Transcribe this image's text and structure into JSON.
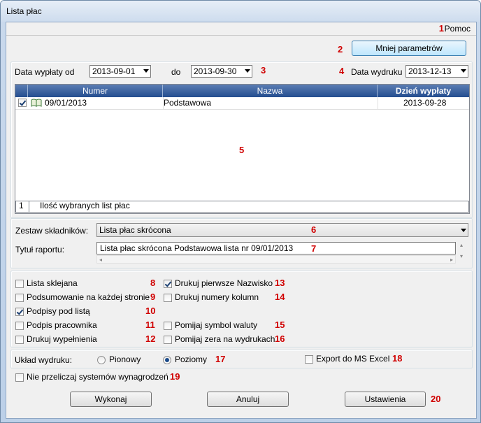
{
  "window": {
    "title": "Lista płac"
  },
  "menu": {
    "help": "Pomoc"
  },
  "markers": [
    "1",
    "2",
    "3",
    "4",
    "5",
    "6",
    "7",
    "8",
    "9",
    "10",
    "11",
    "12",
    "13",
    "14",
    "15",
    "16",
    "17",
    "18",
    "19",
    "20"
  ],
  "params_button": "Mniej parametrów",
  "date_filter": {
    "from_label": "Data wypłaty od",
    "from_value": "2013-09-01",
    "to_label": "do",
    "to_value": "2013-09-30",
    "print_label": "Data wydruku",
    "print_value": "2013-12-13"
  },
  "grid": {
    "columns": [
      "Numer",
      "Nazwa",
      "Dzień wypłaty"
    ],
    "rows": [
      {
        "checked": true,
        "numer": "09/01/2013",
        "nazwa": "Podstawowa",
        "dzien": "2013-09-28"
      }
    ],
    "footer_count": "1",
    "footer_label": "Ilość wybranych list płac"
  },
  "components": {
    "label": "Zestaw składników:",
    "value": "Lista płac skrócona"
  },
  "report_title": {
    "label": "Tytuł raportu:",
    "value": "Lista płac skrócona Podstawowa lista nr 09/01/2013"
  },
  "options_left": [
    {
      "label": "Lista sklejana",
      "checked": false
    },
    {
      "label": "Podsumowanie na każdej stronie",
      "checked": false
    },
    {
      "label": "Podpisy pod listą",
      "checked": true
    },
    {
      "label": "Podpis pracownika",
      "checked": false
    },
    {
      "label": "Drukuj wypełnienia",
      "checked": false
    }
  ],
  "options_right": [
    {
      "label": "Drukuj pierwsze Nazwisko",
      "checked": true
    },
    {
      "label": "Drukuj numery kolumn",
      "checked": false
    },
    {
      "label": "Pomijaj symbol waluty",
      "checked": false
    },
    {
      "label": "Pomijaj zera na wydrukach",
      "checked": false
    }
  ],
  "layout": {
    "label": "Układ wydruku:",
    "portrait": "Pionowy",
    "landscape": "Poziomy",
    "selected": "Poziomy",
    "export_label": "Export do MS Excel",
    "export_checked": false
  },
  "no_recalc": {
    "label": "Nie przeliczaj systemów wynagrodzeń",
    "checked": false
  },
  "buttons": {
    "run": "Wykonaj",
    "cancel": "Anuluj",
    "settings": "Ustawienia"
  },
  "colors": {
    "marker": "#d00000",
    "grid_header": "#234d8f",
    "title_bar": "#cddcee"
  }
}
